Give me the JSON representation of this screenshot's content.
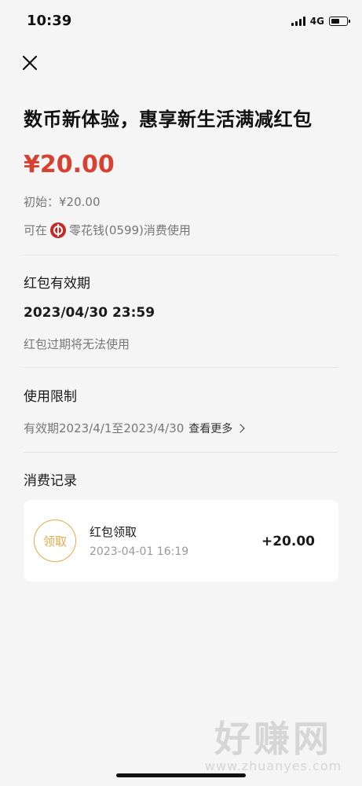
{
  "status_bar": {
    "time": "10:39",
    "network": "4G"
  },
  "header": {
    "close_icon": "close-icon"
  },
  "coupon": {
    "title": "数币新体验，惠享新生活满减红包",
    "amount": "¥20.00",
    "initial_label": "初始：¥20.00",
    "usable_prefix": "可在",
    "merchant": "零花钱(0599)消费使用"
  },
  "validity": {
    "section_title": "红包有效期",
    "expiry": "2023/04/30 23:59",
    "note": "红包过期将无法使用"
  },
  "restriction": {
    "section_title": "使用限制",
    "period": "有效期2023/4/1至2023/4/30",
    "see_more": "查看更多"
  },
  "records": {
    "section_title": "消费记录",
    "items": [
      {
        "badge": "领取",
        "title": "红包领取",
        "time": "2023-04-01 16:19",
        "amount": "+20.00"
      }
    ]
  },
  "watermark": {
    "main": "好赚网",
    "sub": "www.zhuanyes.com"
  },
  "colors": {
    "amount_red": "#d8412f",
    "badge_orange": "#e9a849",
    "background": "#f5f5f5"
  }
}
